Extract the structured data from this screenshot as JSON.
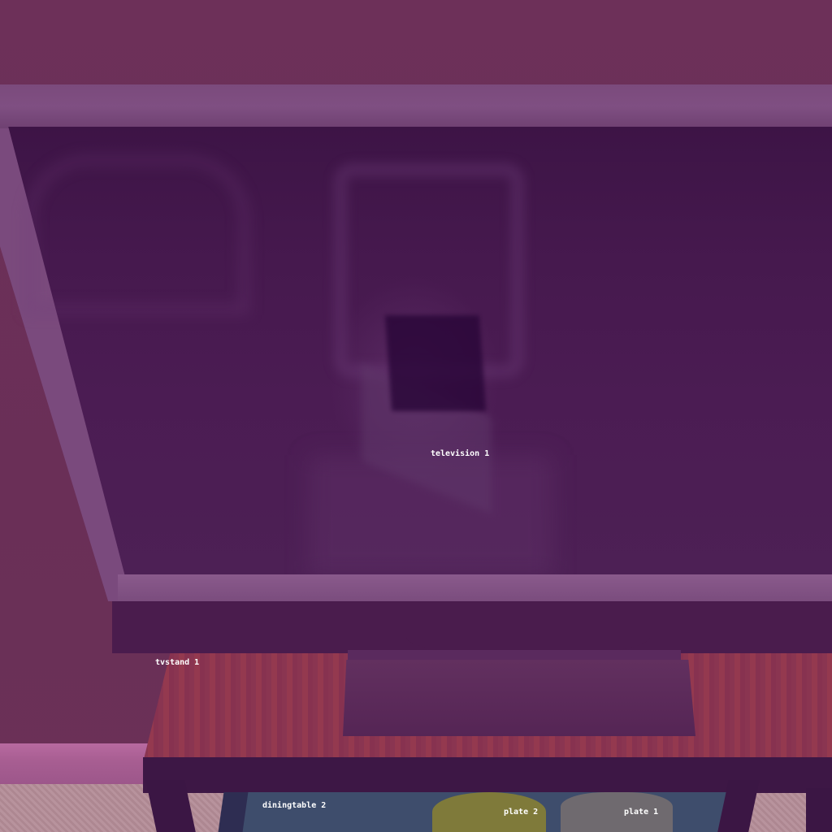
{
  "scene": {
    "labels": {
      "television": "television 1",
      "tvstand": "tvstand 1",
      "diningtable": "diningtable 2",
      "plate_2": "plate 2",
      "plate_1": "plate 1"
    }
  }
}
